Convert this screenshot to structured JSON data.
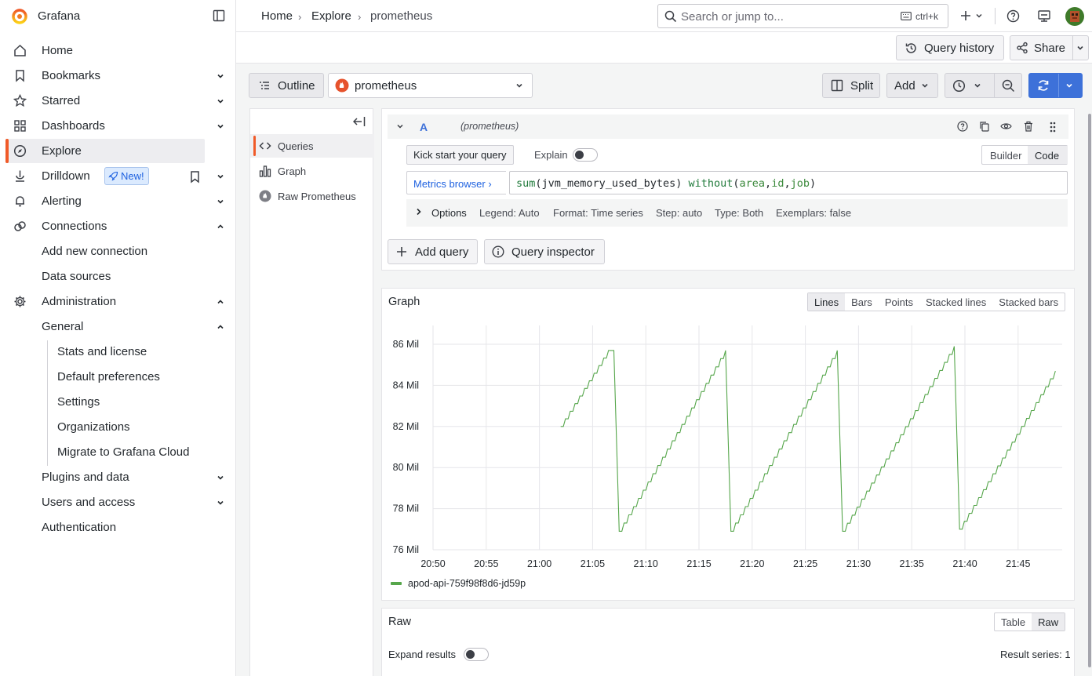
{
  "app": {
    "name": "Grafana"
  },
  "sidebar": {
    "items": [
      {
        "label": "Home",
        "icon": "home-icon"
      },
      {
        "label": "Bookmarks",
        "icon": "bookmark-icon"
      },
      {
        "label": "Starred",
        "icon": "star-icon"
      },
      {
        "label": "Dashboards",
        "icon": "apps-icon"
      },
      {
        "label": "Explore",
        "icon": "compass-icon"
      },
      {
        "label": "Drilldown",
        "icon": "drilldown-icon"
      },
      {
        "label": "Alerting",
        "icon": "bell-icon"
      },
      {
        "label": "Connections",
        "icon": "link-icon"
      },
      {
        "label": "Administration",
        "icon": "cog-icon"
      }
    ],
    "new_badge": "New!",
    "connections_sub": [
      "Add new connection",
      "Data sources"
    ],
    "admin_sub": {
      "general": "General",
      "general_sub": [
        "Stats and license",
        "Default preferences",
        "Settings",
        "Organizations",
        "Migrate to Grafana Cloud"
      ],
      "others": [
        "Plugins and data",
        "Users and access",
        "Authentication"
      ]
    }
  },
  "topbar": {
    "breadcrumbs": [
      "Home",
      "Explore",
      "prometheus"
    ],
    "search_placeholder": "Search or jump to...",
    "search_shortcut": "ctrl+k"
  },
  "toolbar": {
    "query_history": "Query history",
    "share": "Share"
  },
  "explore": {
    "outline": "Outline",
    "datasource": "prometheus",
    "split": "Split",
    "add": "Add"
  },
  "outline_panel": {
    "items": [
      "Queries",
      "Graph",
      "Raw Prometheus"
    ]
  },
  "query": {
    "ref": "A",
    "datasource_label": "(prometheus)",
    "kick_start": "Kick start your query",
    "explain": "Explain",
    "builder": "Builder",
    "code": "Code",
    "metrics_browser": "Metrics browser",
    "expr_func": "sum",
    "expr_metric": "jvm_memory_used_bytes",
    "expr_without": "without",
    "expr_labels": [
      "area",
      "id",
      "job"
    ],
    "options_label": "Options",
    "options": [
      "Legend: Auto",
      "Format: Time series",
      "Step: auto",
      "Type: Both",
      "Exemplars: false"
    ],
    "add_query": "Add query",
    "query_inspector": "Query inspector"
  },
  "graph": {
    "title": "Graph",
    "modes": [
      "Lines",
      "Bars",
      "Points",
      "Stacked lines",
      "Stacked bars"
    ],
    "active_mode": "Lines",
    "series_color": "#56a64b"
  },
  "chart_data": {
    "type": "line",
    "x_ticks": [
      "20:50",
      "20:55",
      "21:00",
      "21:05",
      "21:10",
      "21:15",
      "21:20",
      "21:25",
      "21:30",
      "21:35",
      "21:40",
      "21:45"
    ],
    "y_ticks": [
      "76 Mil",
      "78 Mil",
      "80 Mil",
      "82 Mil",
      "84 Mil",
      "86 Mil"
    ],
    "ylim": [
      76,
      86
    ],
    "y_unit": "Mil",
    "series": [
      {
        "name": "apod-api-759f98f8d6-jd59p",
        "color": "#56a64b",
        "points": [
          [
            "21:02",
            82.0
          ],
          [
            "21:06:30",
            85.7
          ],
          [
            "21:07",
            85.7
          ],
          [
            "21:07:30",
            76.9
          ],
          [
            "21:17:30",
            85.7
          ],
          [
            "21:18",
            76.9
          ],
          [
            "21:28",
            85.7
          ],
          [
            "21:28:30",
            76.9
          ],
          [
            "21:39",
            85.9
          ],
          [
            "21:39:30",
            77.0
          ],
          [
            "21:48:30",
            84.7
          ]
        ]
      }
    ],
    "legend": "bottom-left",
    "grid": true
  },
  "raw": {
    "title": "Raw",
    "table": "Table",
    "raw": "Raw",
    "expand_results": "Expand results",
    "result_series": "Result series: 1"
  }
}
